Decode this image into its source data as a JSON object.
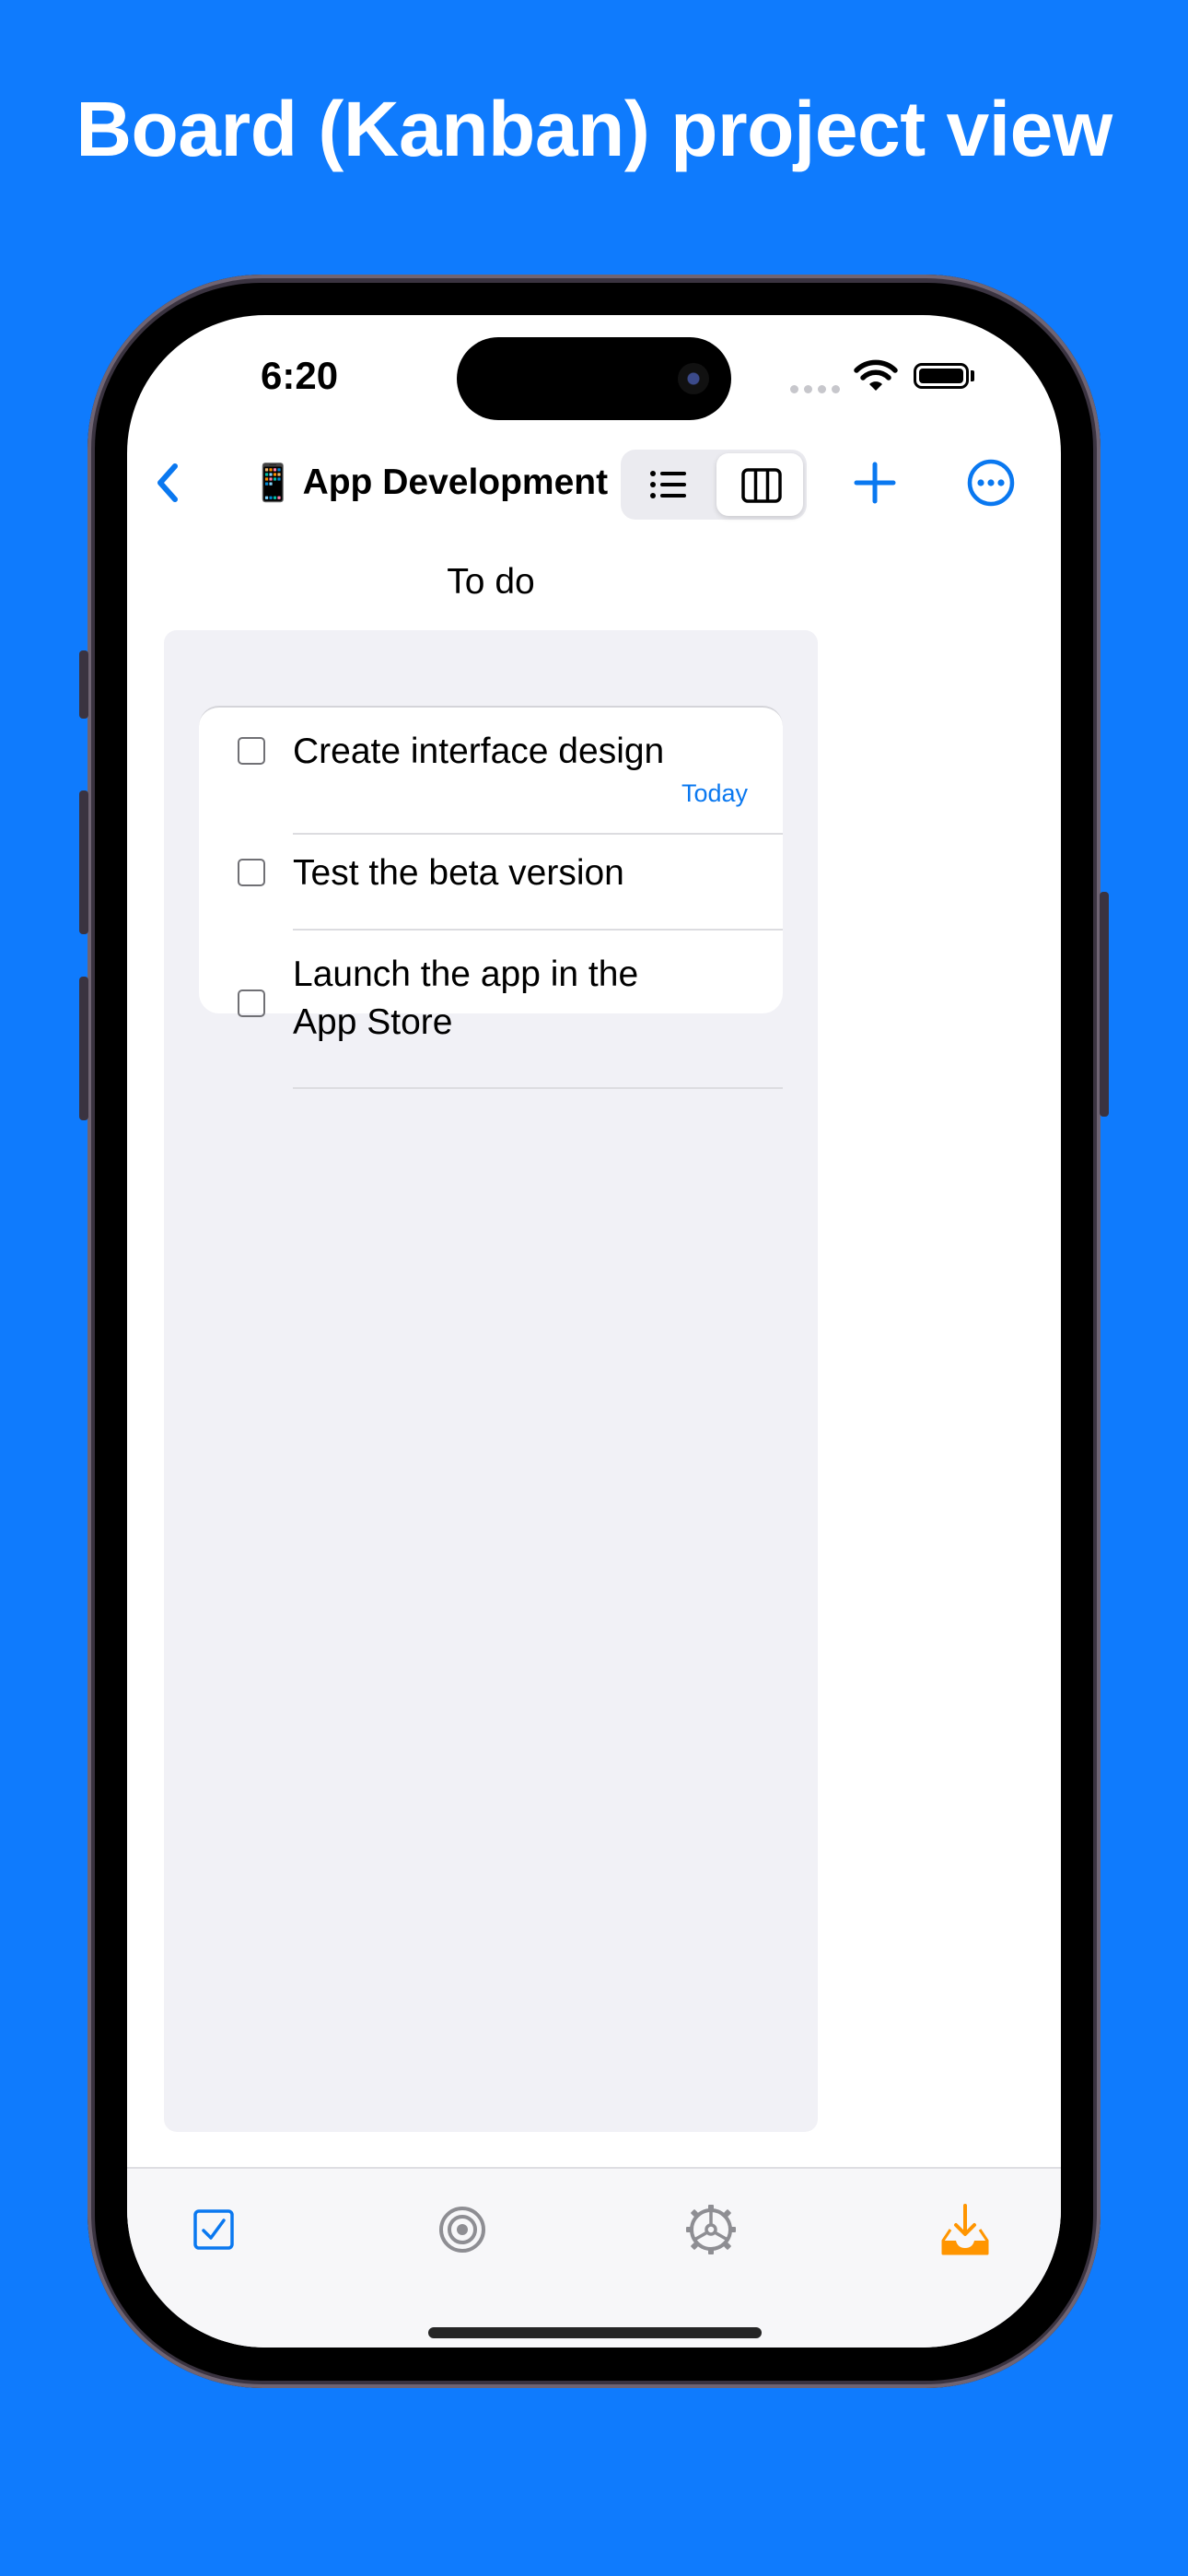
{
  "headline": "Board (Kanban) project view",
  "status_bar": {
    "time": "6:20"
  },
  "nav": {
    "title_emoji": "📱",
    "title": "App Development",
    "view_modes": [
      "list",
      "board"
    ],
    "selected_view": "board"
  },
  "board": {
    "columns": [
      {
        "title": "To do",
        "tasks": [
          {
            "title": "Create interface design",
            "due": "Today",
            "done": false
          },
          {
            "title": "Test the beta version",
            "due": "",
            "done": false
          },
          {
            "title": "Launch the app in the App Store",
            "due": "",
            "done": false
          }
        ]
      }
    ]
  },
  "tab_bar": {
    "items": [
      {
        "icon": "checkbox-icon",
        "color": "#0a78f0"
      },
      {
        "icon": "target-icon",
        "color": "#8e8e93"
      },
      {
        "icon": "settings-icon",
        "color": "#8e8e93"
      },
      {
        "icon": "inbox-icon",
        "color": "#ff9500"
      }
    ]
  },
  "colors": {
    "background": "#0f7bfd",
    "accent": "#0a78f0",
    "inbox": "#ff9500"
  }
}
